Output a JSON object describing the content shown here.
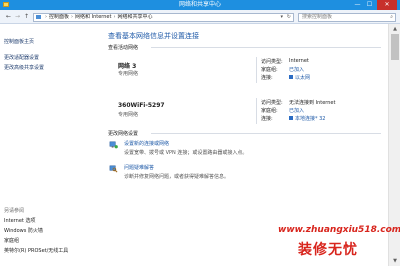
{
  "window": {
    "title": "网络和共享中心",
    "min": "—",
    "max": "☐",
    "close": "✕"
  },
  "nav": {
    "back": "←",
    "forward": "→",
    "up": "↑",
    "path": [
      "控制面板",
      "网络和 Internet",
      "网络和共享中心"
    ],
    "sep": "›",
    "search_placeholder": "搜索控制面板"
  },
  "sidebar": {
    "items": [
      "控制面板主页",
      "更改适配器设置",
      "更改高级共享设置"
    ],
    "see_also_label": "另请参阅",
    "see_also": [
      "Internet 选项",
      "Windows 防火墙",
      "家庭组",
      "英特尔(R) PROSet/无线工具"
    ]
  },
  "main": {
    "heading": "查看基本网络信息并设置连接",
    "active_label": "查看活动网络",
    "networks": [
      {
        "name": "网络  3",
        "type": "专用网络",
        "access_key": "访问类型:",
        "access_val": "Internet",
        "homegroup_key": "家庭组:",
        "homegroup_val": "已加入",
        "conn_key": "连接:",
        "conn_val": "以太网"
      },
      {
        "name": "360WiFi-5297",
        "type": "专用网络",
        "access_key": "访问类型:",
        "access_val": "无法连接到 Internet",
        "homegroup_key": "家庭组:",
        "homegroup_val": "已加入",
        "conn_key": "连接:",
        "conn_val": "本地连接* 32"
      }
    ],
    "change_label": "更改网络设置",
    "tasks": [
      {
        "title": "设置新的连接或网络",
        "desc": "设置宽带、拨号或 VPN 连接；或设置路由器或接入点。"
      },
      {
        "title": "问题疑难解答",
        "desc": "诊断并修复网络问题，或者获得疑难解答信息。"
      }
    ]
  },
  "watermark": {
    "url": "www.zhuangxiu518.com",
    "brand": "装修无忧"
  },
  "colors": {
    "titlebar": "#1e8fe0",
    "link": "#1f5aa8",
    "watermark": "#d8251d"
  }
}
